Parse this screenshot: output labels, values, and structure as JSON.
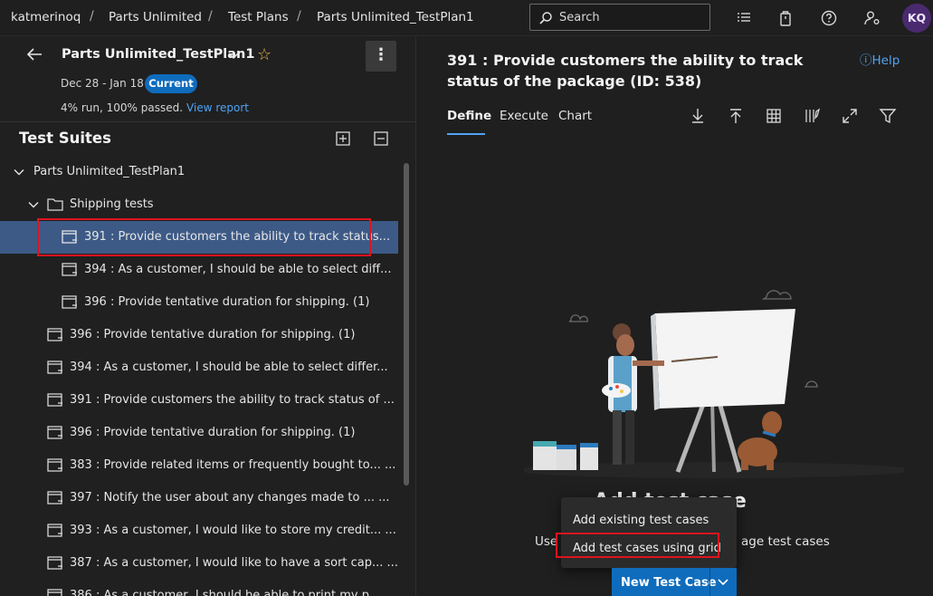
{
  "topbar": {
    "breadcrumbs": [
      "katmerinoq",
      "Parts Unlimited",
      "Test Plans",
      "Parts Unlimited_TestPlan1"
    ],
    "search_placeholder": "Search",
    "avatar_initials": "KQ"
  },
  "plan": {
    "title": "Parts Unlimited_TestPlan1",
    "dates": "Dec 28 - Jan 18",
    "badge": "Current",
    "run_summary": "4% run, 100% passed.",
    "view_report": "View report"
  },
  "suites": {
    "title": "Test Suites",
    "items": [
      {
        "label": "Parts Unlimited_TestPlan1",
        "level": 0,
        "kind": "plan"
      },
      {
        "label": "Shipping tests",
        "level": 1,
        "kind": "folder"
      },
      {
        "label": "391 : Provide customers the ability to track status...",
        "level": 2,
        "kind": "suite",
        "selected": true
      },
      {
        "label": "394 : As a customer, I should be able to select diff...",
        "level": 2,
        "kind": "suite"
      },
      {
        "label": "396 : Provide tentative duration for shipping. (1)",
        "level": 2,
        "kind": "suite"
      },
      {
        "label": "396 : Provide tentative duration for shipping. (1)",
        "level": 1,
        "kind": "suite"
      },
      {
        "label": "394 : As a customer, I should be able to select differ...",
        "level": 1,
        "kind": "suite"
      },
      {
        "label": "391 : Provide customers the ability to track status of ...",
        "level": 1,
        "kind": "suite"
      },
      {
        "label": "396 : Provide tentative duration for shipping. (1)",
        "level": 1,
        "kind": "suite"
      },
      {
        "label": "383 : Provide related items or frequently bought to...  ...",
        "level": 1,
        "kind": "suite"
      },
      {
        "label": "397 : Notify the user about any changes made to ...  ...",
        "level": 1,
        "kind": "suite"
      },
      {
        "label": "393 : As a customer, I would like to store my credit...  ...",
        "level": 1,
        "kind": "suite"
      },
      {
        "label": "387 : As a customer, I would like to have a sort cap...  ...",
        "level": 1,
        "kind": "suite"
      },
      {
        "label": "386 : As a customer, I should be able to print my p...",
        "level": 1,
        "kind": "suite"
      }
    ]
  },
  "detail": {
    "title": "391 : Provide customers the ability to track status of the package (ID: 538)",
    "help": "Help",
    "tabs": [
      "Define",
      "Execute",
      "Chart"
    ],
    "empty_title": "Add test case",
    "empty_sub_left": "Use t",
    "empty_sub_right": "age test cases",
    "dropdown": [
      "Add existing test cases",
      "Add test cases using grid"
    ],
    "new_test_case": "New Test Case"
  },
  "colors": {
    "accent": "#0f6cbd",
    "link": "#4ea4f5",
    "selection": "#3d5a87",
    "highlight_box": "#e0141e"
  }
}
